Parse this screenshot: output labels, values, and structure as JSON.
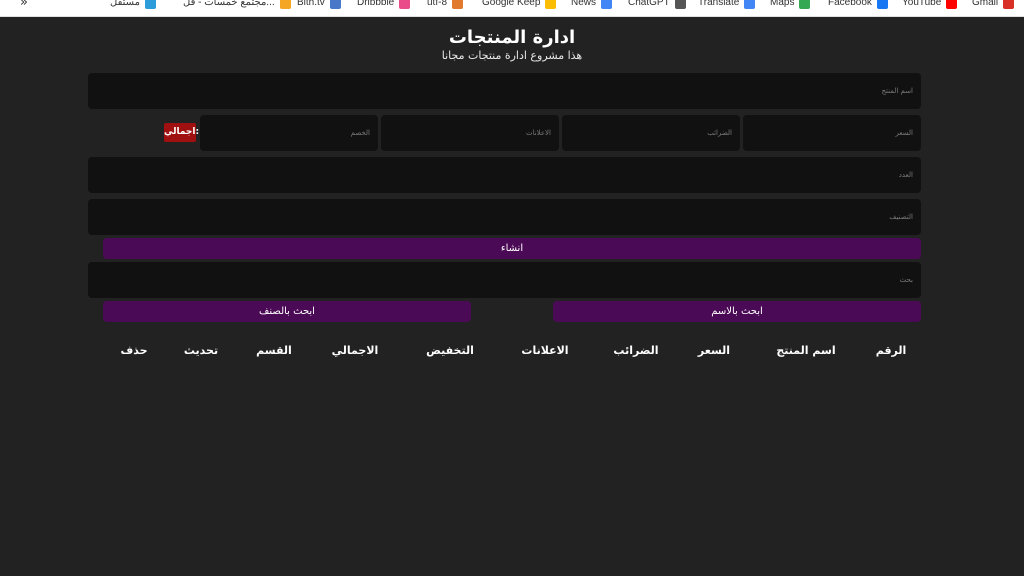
{
  "bookmarks": [
    {
      "label": "Gmail",
      "icon": "gmail-icon",
      "color": "#d93025"
    },
    {
      "label": "YouTube",
      "icon": "youtube-icon",
      "color": "#ff0000"
    },
    {
      "label": "Facebook",
      "icon": "facebook-icon",
      "color": "#1877f2"
    },
    {
      "label": "Maps",
      "icon": "maps-icon",
      "color": "#34a853"
    },
    {
      "label": "Translate",
      "icon": "translate-icon",
      "color": "#4285f4"
    },
    {
      "label": "ChatGPT",
      "icon": "chatgpt-icon",
      "color": "#555555"
    },
    {
      "label": "News",
      "icon": "news-icon",
      "color": "#4285f4"
    },
    {
      "label": "Google Keep",
      "icon": "keep-icon",
      "color": "#fbbc04"
    },
    {
      "label": "utf-8",
      "icon": "utf8-icon",
      "color": "#e07a2e"
    },
    {
      "label": "Dribbble",
      "icon": "dribbble-icon",
      "color": "#ea4c89"
    },
    {
      "label": "Bith.tv",
      "icon": "bithtv-icon",
      "color": "#4a78c8"
    },
    {
      "label": "مجتمع خمسات - قل...",
      "icon": "khamsat-icon",
      "color": "#f5a623"
    },
    {
      "label": "مستقل",
      "icon": "mostaql-icon",
      "color": "#2c9cdb"
    }
  ],
  "bookmarks_overflow": "»",
  "header": {
    "title": "ادارة المنتجات",
    "subtitle": "هذا مشروع ادارة منتجات مجانا"
  },
  "form": {
    "name_placeholder": "اسم المنتج",
    "price_placeholder": "السعر",
    "taxes_placeholder": "الضرائب",
    "ads_placeholder": "الاعلانات",
    "discount_placeholder": "الخصم",
    "total_label": "اجمالي:",
    "count_placeholder": "العدد",
    "category_placeholder": "التصنيف",
    "create_label": "انشاء"
  },
  "search": {
    "placeholder": "بحث",
    "by_name_label": "ابحث بالاسم",
    "by_category_label": "ابحث بالصنف"
  },
  "table": {
    "headers": [
      "الرقم",
      "اسم المنتج",
      "السعر",
      "الضرائب",
      "الاعلانات",
      "التخفيض",
      "الاجمالي",
      "القسم",
      "تحديث",
      "حذف"
    ]
  },
  "colors": {
    "background": "#222222",
    "input": "#111111",
    "button": "#4b0a55",
    "total_badge": "#a01010"
  }
}
